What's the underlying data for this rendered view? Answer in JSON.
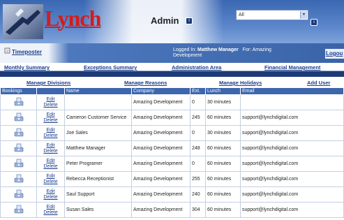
{
  "header": {
    "logo_text": "Lynch",
    "admin_label": "Admin",
    "admin_button": "i",
    "filter_select": "All",
    "go_button": "i"
  },
  "infobar": {
    "timeposter": "Timeposter",
    "logged_in_label": "Logged In:",
    "logged_in_user": "Matthew Manager",
    "for_label": "For: Amazing",
    "company_cont": "Development",
    "logout": "Logou"
  },
  "nav": {
    "primary": [
      "Monthly Summary",
      "Exceptions Summary",
      "Administration Area",
      "Financial Management"
    ],
    "secondary": [
      "Manage Divisions",
      "Manage Reasons",
      "Manage Holidays",
      "Add User"
    ]
  },
  "table": {
    "headers": [
      "Bookings",
      "",
      "Name",
      "Company",
      "Ext.",
      "Lunch",
      "Email"
    ],
    "edit_label": "Edit",
    "delete_label": "Delete",
    "rows": [
      {
        "name": "",
        "company": "Amazing Development",
        "ext": "0",
        "lunch": "30 minutes",
        "email": ""
      },
      {
        "name": "Cameron Customer Service",
        "company": "Amazing Development",
        "ext": "245",
        "lunch": "60 minutes",
        "email": "support@lynchdigital.com"
      },
      {
        "name": "Joe Sales",
        "company": "Amazing Development",
        "ext": "0",
        "lunch": "30 minutes",
        "email": "support@lynchdigital.com"
      },
      {
        "name": "Matthew Manager",
        "company": "Amazing Development",
        "ext": "248",
        "lunch": "60 minutes",
        "email": "support@lynchdigital.com"
      },
      {
        "name": "Peter Programer",
        "company": "Amazing Development",
        "ext": "0",
        "lunch": "60 minutes",
        "email": "support@lynchdigital.com"
      },
      {
        "name": "Rebecca Receptionist",
        "company": "Amazing Development",
        "ext": "255",
        "lunch": "60 minutes",
        "email": "support@lynchdigital.com"
      },
      {
        "name": "Saul Support",
        "company": "Amazing Development",
        "ext": "240",
        "lunch": "60 minutes",
        "email": "support@lynchdigital.com"
      },
      {
        "name": "Susan Sales",
        "company": "Amazing Development",
        "ext": "304",
        "lunch": "60 minutes",
        "email": "support@lynchdigital.com"
      }
    ]
  },
  "colors": {
    "brand_red": "#d11d1d",
    "header_blue": "#3d66ad",
    "link_blue": "#1a3c8a",
    "separator": "#1d3a78"
  },
  "icons": {
    "logo": "lynch-logo-icon",
    "timeposter": "clipboard-icon",
    "booking": "bookings-icon"
  }
}
